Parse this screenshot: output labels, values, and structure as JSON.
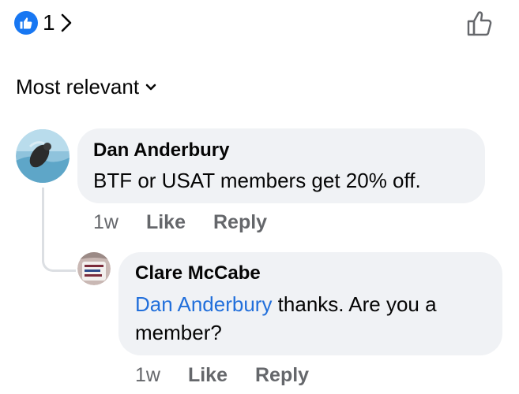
{
  "reactions": {
    "count": "1",
    "icon": "thumbs-up-icon",
    "badge_color": "#1877f2"
  },
  "sort": {
    "label": "Most relevant"
  },
  "comments": [
    {
      "author": "Dan Anderbury",
      "text": "BTF or USAT members get 20% off.",
      "time": "1w",
      "like_label": "Like",
      "reply_label": "Reply"
    },
    {
      "author": "Clare McCabe",
      "mention": "Dan Anderbury",
      "text": " thanks. Are you a member?",
      "time": "1w",
      "like_label": "Like",
      "reply_label": "Reply"
    }
  ],
  "colors": {
    "bubble": "#f0f2f5",
    "mention": "#216fdb",
    "meta": "#65676b",
    "text": "#050505"
  }
}
